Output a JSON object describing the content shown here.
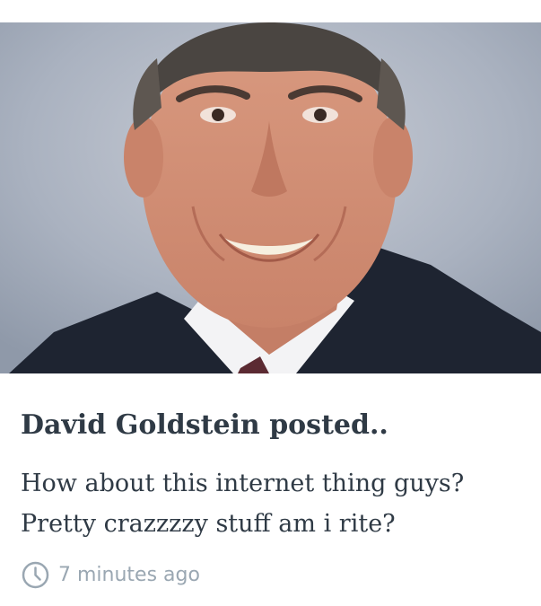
{
  "post": {
    "author_line": "David Goldstein posted..",
    "body": "How about this internet thing guys? Pretty crazzzzy stuff am i rite?",
    "timestamp": "7 minutes ago",
    "meta_icon": "clock-icon"
  },
  "colors": {
    "text": "#2f3a45",
    "muted": "#9aa7b2",
    "background": "#ffffff"
  }
}
